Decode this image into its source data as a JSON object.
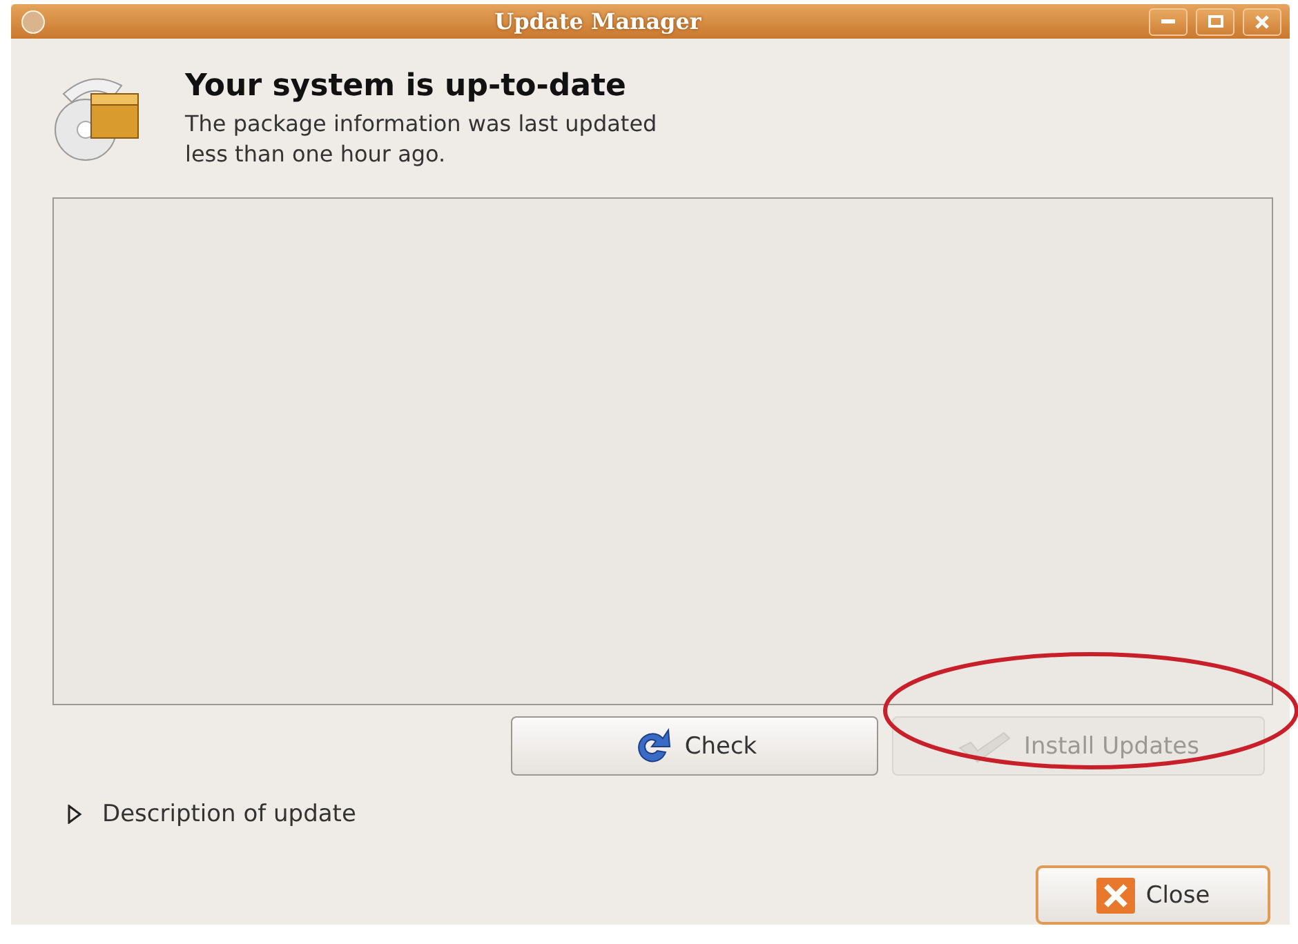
{
  "window": {
    "title": "Update Manager"
  },
  "header": {
    "title": "Your system is up-to-date",
    "message": "The package information was last updated less than one hour ago."
  },
  "buttons": [
    {
      "kind": "check",
      "label": "Check",
      "disabled": false
    },
    {
      "kind": "install",
      "label": "Install Updates",
      "disabled": true
    }
  ],
  "expander": {
    "label": "Description of update",
    "expanded": false
  },
  "close_button": {
    "label": "Close",
    "disabled": false
  }
}
